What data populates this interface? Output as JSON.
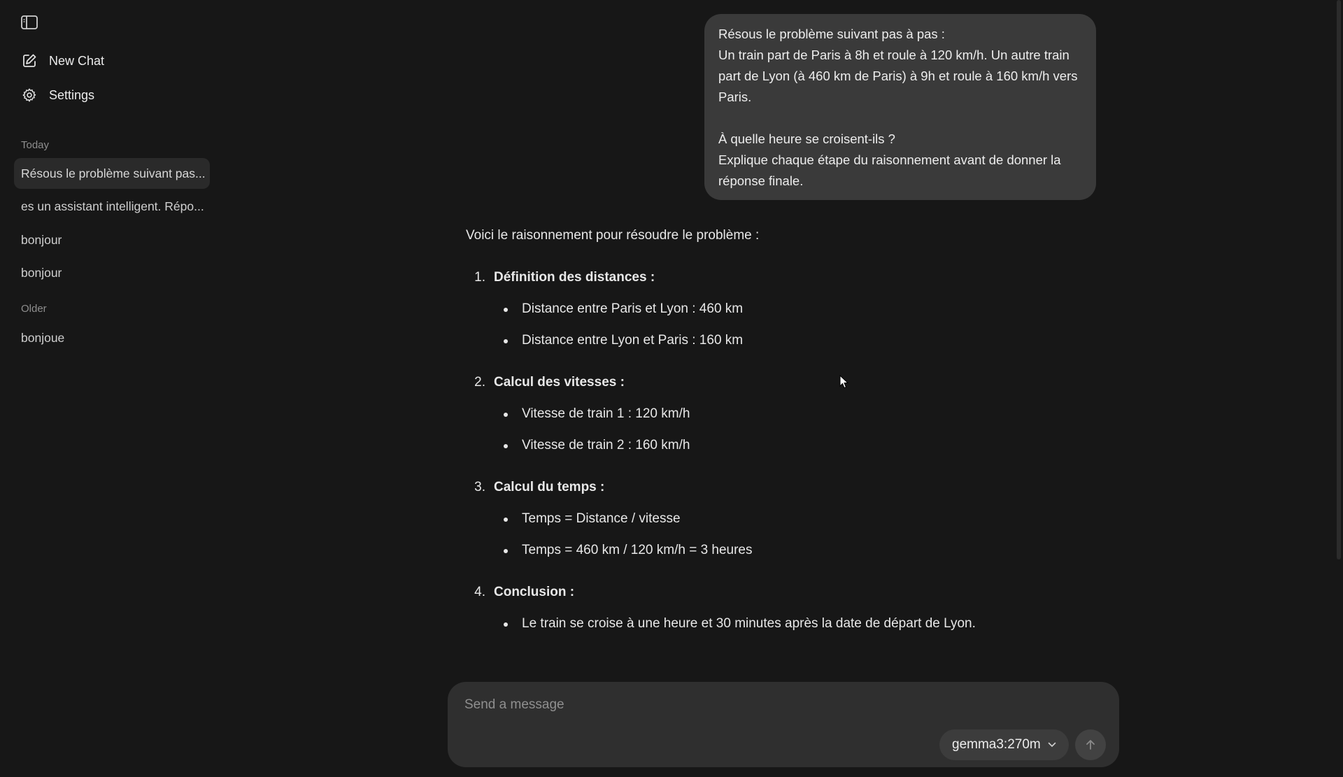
{
  "sidebar": {
    "new_chat_label": "New Chat",
    "settings_label": "Settings",
    "sections": {
      "today": "Today",
      "older": "Older"
    },
    "today_items": [
      {
        "label": "Résous le problème suivant pas..."
      },
      {
        "label": "es un assistant intelligent. Répo..."
      },
      {
        "label": "bonjour"
      },
      {
        "label": "bonjour"
      }
    ],
    "older_items": [
      {
        "label": "bonjoue"
      }
    ]
  },
  "chat": {
    "user_message": {
      "lines": [
        "Résous le problème suivant pas à pas :",
        "Un train part de Paris à 8h et roule à 120 km/h. Un autre train part de Lyon (à 460 km de Paris) à 9h et roule à 160 km/h vers Paris.",
        "",
        "À quelle heure se croisent-ils ?",
        "Explique chaque étape du raisonnement avant de donner la réponse finale."
      ]
    },
    "assistant_message": {
      "intro": "Voici le raisonnement pour résoudre le problème :",
      "steps": [
        {
          "number": "1.",
          "title": "Définition des distances :",
          "bullets": [
            "Distance entre Paris et Lyon : 460 km",
            "Distance entre Lyon et Paris : 160 km"
          ]
        },
        {
          "number": "2.",
          "title": "Calcul des vitesses :",
          "bullets": [
            "Vitesse de train 1 : 120 km/h",
            "Vitesse de train 2 : 160 km/h"
          ]
        },
        {
          "number": "3.",
          "title": "Calcul du temps :",
          "bullets": [
            "Temps = Distance / vitesse",
            "Temps = 460 km / 120 km/h = 3 heures"
          ]
        },
        {
          "number": "4.",
          "title": "Conclusion :",
          "bullets": [
            "Le train se croise à une heure et 30 minutes après la date de départ de Lyon."
          ]
        }
      ]
    }
  },
  "composer": {
    "placeholder": "Send a message",
    "model": "gemma3:270m"
  },
  "icons": {
    "sidebar_toggle": "sidebar-toggle-icon",
    "new_chat": "edit-icon",
    "settings": "gear-icon",
    "model_dropdown": "chevron-down-icon",
    "send": "arrow-up-icon"
  }
}
